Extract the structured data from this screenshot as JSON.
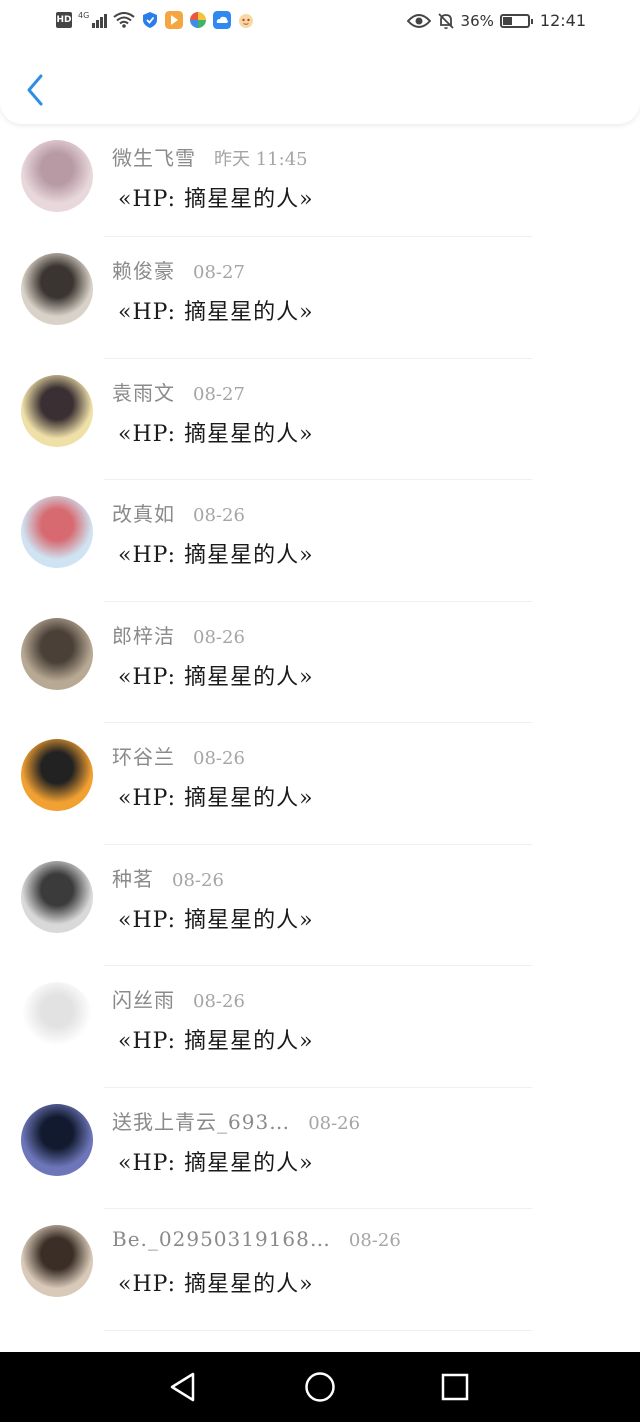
{
  "status_bar": {
    "hd": "HD",
    "network": "4G",
    "battery_pct": "36%",
    "battery_level": 0.36,
    "time": "12:41",
    "icons": [
      "hd-icon",
      "signal-icon",
      "wifi-icon",
      "shield-app-icon",
      "play-app-icon",
      "pinwheel-app-icon",
      "cloud-app-icon",
      "cat-app-icon",
      "eye-icon",
      "bell-muted-icon",
      "battery-icon"
    ]
  },
  "header": {
    "back_icon": "chevron-left-icon",
    "accent_color": "#2e8ee6"
  },
  "rows": [
    {
      "name": "微生飞雪",
      "time": "昨天 11:45",
      "message": "«HP: 摘星星的人»",
      "avatar_colors": [
        "#e8d8dc",
        "#b89aa4"
      ]
    },
    {
      "name": "赖俊豪",
      "time": "08-27",
      "message": "«HP: 摘星星的人»",
      "avatar_colors": [
        "#d9d2c8",
        "#3a3530"
      ]
    },
    {
      "name": "袁雨文",
      "time": "08-27",
      "message": "«HP: 摘星星的人»",
      "avatar_colors": [
        "#efe0a8",
        "#3a2f32"
      ]
    },
    {
      "name": "改真如",
      "time": "08-26",
      "message": "«HP: 摘星星的人»",
      "avatar_colors": [
        "#cfe3f2",
        "#d76a70"
      ]
    },
    {
      "name": "郎梓洁",
      "time": "08-26",
      "message": "«HP: 摘星星的人»",
      "avatar_colors": [
        "#b8a994",
        "#4a4038"
      ]
    },
    {
      "name": "环谷兰",
      "time": "08-26",
      "message": "«HP: 摘星星的人»",
      "avatar_colors": [
        "#f1a032",
        "#222222"
      ]
    },
    {
      "name": "种茗",
      "time": "08-26",
      "message": "«HP: 摘星星的人»",
      "avatar_colors": [
        "#d9d9d9",
        "#3b3b3b"
      ]
    },
    {
      "name": "闪丝雨",
      "time": "08-26",
      "message": "«HP: 摘星星的人»",
      "avatar_colors": [
        "#ffffff",
        "#e2e2e2"
      ]
    },
    {
      "name": "送我上青云_693…",
      "time": "08-26",
      "message": "«HP: 摘星星的人»",
      "avatar_colors": [
        "#6d76b8",
        "#111a2e"
      ]
    },
    {
      "name": "Be._02950319168…",
      "time": "08-26",
      "message": "«HP: 摘星星的人»",
      "avatar_colors": [
        "#d8c9b8",
        "#3a2e26"
      ]
    }
  ],
  "navbar": {
    "icons": [
      "back-triangle-icon",
      "home-circle-icon",
      "recents-square-icon"
    ]
  }
}
